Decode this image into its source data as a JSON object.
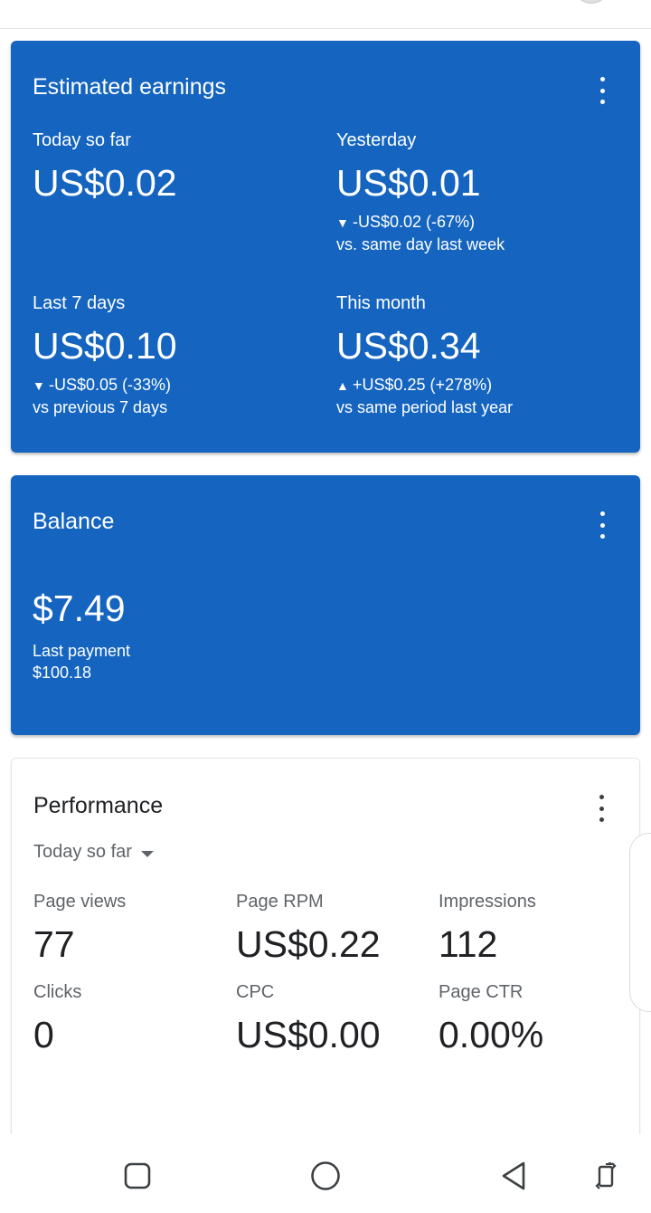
{
  "estimated_earnings": {
    "title": "Estimated earnings",
    "today": {
      "label": "Today so far",
      "value": "US$0.02"
    },
    "yesterday": {
      "label": "Yesterday",
      "value": "US$0.01",
      "arrow": "▼",
      "delta": "-US$0.02 (-67%)",
      "comparison": "vs. same day last week"
    },
    "last7": {
      "label": "Last 7 days",
      "value": "US$0.10",
      "arrow": "▼",
      "delta": "-US$0.05 (-33%)",
      "comparison": "vs previous 7 days"
    },
    "month": {
      "label": "This month",
      "value": "US$0.34",
      "arrow": "▲",
      "delta": "+US$0.25 (+278%)",
      "comparison": "vs same period last year"
    }
  },
  "balance": {
    "title": "Balance",
    "amount": "$7.49",
    "last_payment_label": "Last payment",
    "last_payment_value": "$100.18"
  },
  "performance": {
    "title": "Performance",
    "range_selected": "Today so far",
    "metrics": [
      {
        "label": "Page views",
        "value": "77"
      },
      {
        "label": "Page RPM",
        "value": "US$0.22"
      },
      {
        "label": "Impressions",
        "value": "112"
      },
      {
        "label": "Clicks",
        "value": "0"
      },
      {
        "label": "CPC",
        "value": "US$0.00"
      },
      {
        "label": "Page CTR",
        "value": "0.00%"
      }
    ]
  },
  "colors": {
    "card_blue": "#1565c0",
    "text_dark": "#202124",
    "text_muted": "#5f6368"
  },
  "icons": {
    "card_menu": "more-vert-icon",
    "dropdown": "dropdown-caret-icon",
    "nav": [
      "recents-square-icon",
      "home-circle-icon",
      "back-triangle-icon",
      "rotate-icon"
    ]
  }
}
